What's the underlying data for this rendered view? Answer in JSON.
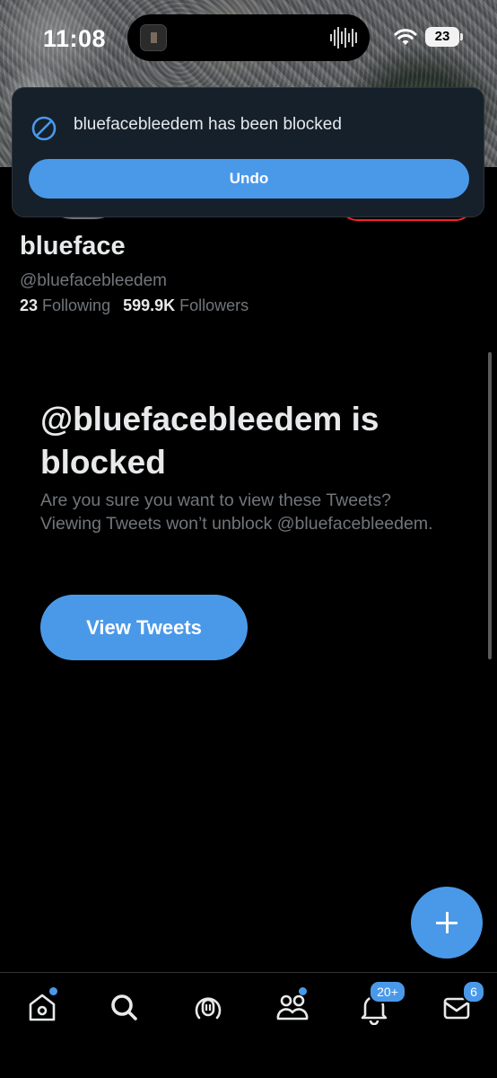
{
  "status_bar": {
    "time": "11:08",
    "battery": "23"
  },
  "toast": {
    "message": "bluefacebleedem has been blocked",
    "undo_label": "Undo"
  },
  "profile": {
    "name": "blueface",
    "handle": "@bluefacebleedem",
    "following_count": "23",
    "following_label": "Following",
    "followers_count": "599.9K",
    "followers_label": "Followers"
  },
  "blocked": {
    "title": "@bluefacebleedem is blocked",
    "description": "Are you sure you want to view these Tweets? Viewing Tweets won’t unblock @bluefacebleedem.",
    "view_button": "View Tweets"
  },
  "bottom_nav": {
    "items": [
      "home-icon",
      "search-icon",
      "spaces-icon",
      "communities-icon",
      "notifications-icon",
      "messages-icon"
    ],
    "notifications_badge": "20+",
    "messages_badge": "6"
  },
  "colors": {
    "accent": "#4a99e9",
    "background": "#000000",
    "toast_bg": "#15202b"
  }
}
